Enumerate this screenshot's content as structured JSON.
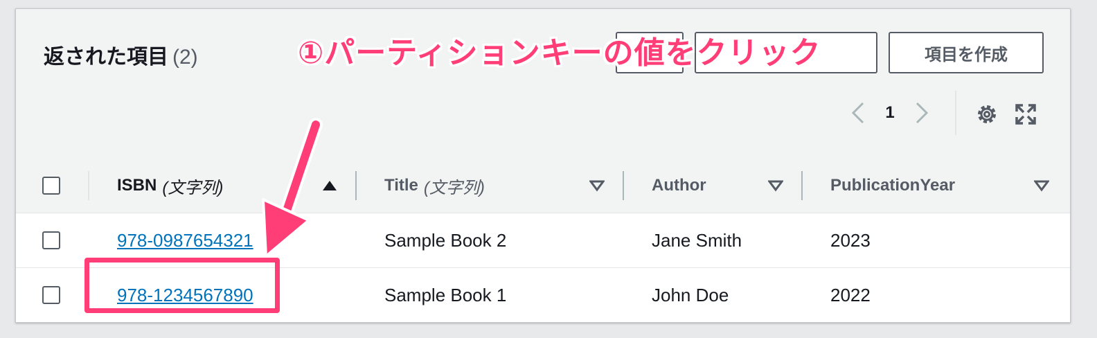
{
  "header": {
    "title": "返された項目",
    "count": "(2)",
    "create_button": "項目を作成"
  },
  "annotation": "①パーティションキーの値をクリック",
  "pagination": {
    "current_page": "1"
  },
  "columns": [
    {
      "name": "ISBN",
      "type": "(文字列)"
    },
    {
      "name": "Title",
      "type": "(文字列)"
    },
    {
      "name": "Author",
      "type": ""
    },
    {
      "name": "PublicationYear",
      "type": ""
    }
  ],
  "rows": [
    {
      "isbn": "978-0987654321",
      "title": "Sample Book 2",
      "author": "Jane Smith",
      "year": "2023"
    },
    {
      "isbn": "978-1234567890",
      "title": "Sample Book 1",
      "author": "John Doe",
      "year": "2022"
    }
  ],
  "colors": {
    "accent": "#ff3d77",
    "link": "#0073bb"
  },
  "icons": [
    "chevron-left-icon",
    "chevron-right-icon",
    "gear-icon",
    "expand-icon",
    "sort-ascending-icon",
    "sort-descending-icon"
  ]
}
